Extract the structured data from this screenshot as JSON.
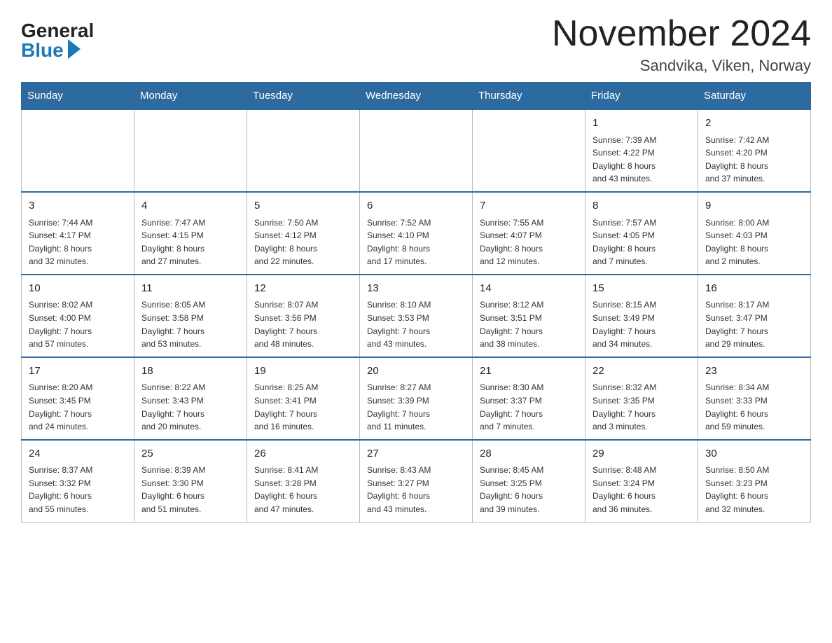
{
  "header": {
    "logo_general": "General",
    "logo_blue": "Blue",
    "month_title": "November 2024",
    "location": "Sandvika, Viken, Norway"
  },
  "weekdays": [
    "Sunday",
    "Monday",
    "Tuesday",
    "Wednesday",
    "Thursday",
    "Friday",
    "Saturday"
  ],
  "weeks": [
    [
      {
        "day": "",
        "info": "",
        "empty": true
      },
      {
        "day": "",
        "info": "",
        "empty": true
      },
      {
        "day": "",
        "info": "",
        "empty": true
      },
      {
        "day": "",
        "info": "",
        "empty": true
      },
      {
        "day": "",
        "info": "",
        "empty": true
      },
      {
        "day": "1",
        "info": "Sunrise: 7:39 AM\nSunset: 4:22 PM\nDaylight: 8 hours\nand 43 minutes."
      },
      {
        "day": "2",
        "info": "Sunrise: 7:42 AM\nSunset: 4:20 PM\nDaylight: 8 hours\nand 37 minutes."
      }
    ],
    [
      {
        "day": "3",
        "info": "Sunrise: 7:44 AM\nSunset: 4:17 PM\nDaylight: 8 hours\nand 32 minutes."
      },
      {
        "day": "4",
        "info": "Sunrise: 7:47 AM\nSunset: 4:15 PM\nDaylight: 8 hours\nand 27 minutes."
      },
      {
        "day": "5",
        "info": "Sunrise: 7:50 AM\nSunset: 4:12 PM\nDaylight: 8 hours\nand 22 minutes."
      },
      {
        "day": "6",
        "info": "Sunrise: 7:52 AM\nSunset: 4:10 PM\nDaylight: 8 hours\nand 17 minutes."
      },
      {
        "day": "7",
        "info": "Sunrise: 7:55 AM\nSunset: 4:07 PM\nDaylight: 8 hours\nand 12 minutes."
      },
      {
        "day": "8",
        "info": "Sunrise: 7:57 AM\nSunset: 4:05 PM\nDaylight: 8 hours\nand 7 minutes."
      },
      {
        "day": "9",
        "info": "Sunrise: 8:00 AM\nSunset: 4:03 PM\nDaylight: 8 hours\nand 2 minutes."
      }
    ],
    [
      {
        "day": "10",
        "info": "Sunrise: 8:02 AM\nSunset: 4:00 PM\nDaylight: 7 hours\nand 57 minutes."
      },
      {
        "day": "11",
        "info": "Sunrise: 8:05 AM\nSunset: 3:58 PM\nDaylight: 7 hours\nand 53 minutes."
      },
      {
        "day": "12",
        "info": "Sunrise: 8:07 AM\nSunset: 3:56 PM\nDaylight: 7 hours\nand 48 minutes."
      },
      {
        "day": "13",
        "info": "Sunrise: 8:10 AM\nSunset: 3:53 PM\nDaylight: 7 hours\nand 43 minutes."
      },
      {
        "day": "14",
        "info": "Sunrise: 8:12 AM\nSunset: 3:51 PM\nDaylight: 7 hours\nand 38 minutes."
      },
      {
        "day": "15",
        "info": "Sunrise: 8:15 AM\nSunset: 3:49 PM\nDaylight: 7 hours\nand 34 minutes."
      },
      {
        "day": "16",
        "info": "Sunrise: 8:17 AM\nSunset: 3:47 PM\nDaylight: 7 hours\nand 29 minutes."
      }
    ],
    [
      {
        "day": "17",
        "info": "Sunrise: 8:20 AM\nSunset: 3:45 PM\nDaylight: 7 hours\nand 24 minutes."
      },
      {
        "day": "18",
        "info": "Sunrise: 8:22 AM\nSunset: 3:43 PM\nDaylight: 7 hours\nand 20 minutes."
      },
      {
        "day": "19",
        "info": "Sunrise: 8:25 AM\nSunset: 3:41 PM\nDaylight: 7 hours\nand 16 minutes."
      },
      {
        "day": "20",
        "info": "Sunrise: 8:27 AM\nSunset: 3:39 PM\nDaylight: 7 hours\nand 11 minutes."
      },
      {
        "day": "21",
        "info": "Sunrise: 8:30 AM\nSunset: 3:37 PM\nDaylight: 7 hours\nand 7 minutes."
      },
      {
        "day": "22",
        "info": "Sunrise: 8:32 AM\nSunset: 3:35 PM\nDaylight: 7 hours\nand 3 minutes."
      },
      {
        "day": "23",
        "info": "Sunrise: 8:34 AM\nSunset: 3:33 PM\nDaylight: 6 hours\nand 59 minutes."
      }
    ],
    [
      {
        "day": "24",
        "info": "Sunrise: 8:37 AM\nSunset: 3:32 PM\nDaylight: 6 hours\nand 55 minutes."
      },
      {
        "day": "25",
        "info": "Sunrise: 8:39 AM\nSunset: 3:30 PM\nDaylight: 6 hours\nand 51 minutes."
      },
      {
        "day": "26",
        "info": "Sunrise: 8:41 AM\nSunset: 3:28 PM\nDaylight: 6 hours\nand 47 minutes."
      },
      {
        "day": "27",
        "info": "Sunrise: 8:43 AM\nSunset: 3:27 PM\nDaylight: 6 hours\nand 43 minutes."
      },
      {
        "day": "28",
        "info": "Sunrise: 8:45 AM\nSunset: 3:25 PM\nDaylight: 6 hours\nand 39 minutes."
      },
      {
        "day": "29",
        "info": "Sunrise: 8:48 AM\nSunset: 3:24 PM\nDaylight: 6 hours\nand 36 minutes."
      },
      {
        "day": "30",
        "info": "Sunrise: 8:50 AM\nSunset: 3:23 PM\nDaylight: 6 hours\nand 32 minutes."
      }
    ]
  ]
}
